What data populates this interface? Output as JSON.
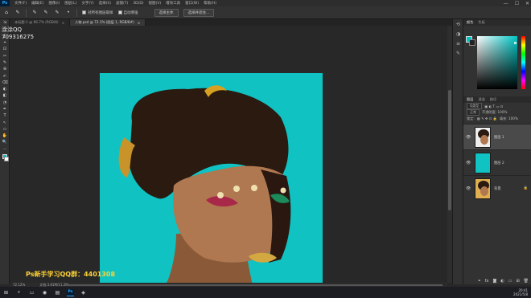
{
  "app": {
    "logo": "Ps"
  },
  "menu": [
    "文件(F)",
    "编辑(E)",
    "图像(I)",
    "图层(L)",
    "文字(Y)",
    "选择(S)",
    "滤镜(T)",
    "3D(D)",
    "视图(V)",
    "增效工具",
    "窗口(W)",
    "帮助(H)"
  ],
  "window_controls": [
    "—",
    "☐",
    "✕"
  ],
  "options_bar": {
    "sample_all_layers": "对所有图层取样",
    "enhance_edge": "自动增强",
    "select_subject": "选择主体",
    "select_mask": "选择并遮住..."
  },
  "tabs": [
    {
      "label": "未标题-1 @ 66.7% (RGB/8)",
      "active": false
    },
    {
      "label": "人物.psd @ 72.1% (图层 1, RGB/8#)",
      "active": true
    }
  ],
  "tools": [
    "⇲",
    "⬚",
    "ʆ",
    "⌖",
    "⊡",
    "✂",
    "✎",
    "⊕",
    "✍",
    "⌫",
    "◐",
    "◧",
    "◔",
    "✒",
    "T",
    "↖",
    "▭",
    "✋",
    "🔍",
    "···"
  ],
  "watermark": {
    "name": "涂涂QQ",
    "number": "709316275",
    "group": "Ps新手学习QQ群：4401308"
  },
  "status": {
    "zoom": "72.12%",
    "doc": "文档:3.81M/11.2M"
  },
  "panels": {
    "color_tabs": [
      "颜色",
      "色板"
    ],
    "layers_tabs": [
      "图层",
      "通道",
      "路径"
    ],
    "search_label": "Q类型",
    "blend_mode": "正常",
    "opacity": "不透明度: 100%",
    "lock_label": "锁定:",
    "fill": "填充: 100%"
  },
  "layers": [
    {
      "name": "图层 1",
      "selected": true,
      "thumb_color": "#c9a27a"
    },
    {
      "name": "图层 2",
      "selected": false,
      "thumb_color": "#10c2c2"
    },
    {
      "name": "背景",
      "selected": false,
      "thumb_color": "#e0b050"
    }
  ],
  "colors": {
    "background": "#10c2c2",
    "accent": "#31a8ff",
    "watermark_yellow": "#ffd233"
  },
  "taskbar": {
    "time": "20:41",
    "date": "2021/5/8"
  }
}
